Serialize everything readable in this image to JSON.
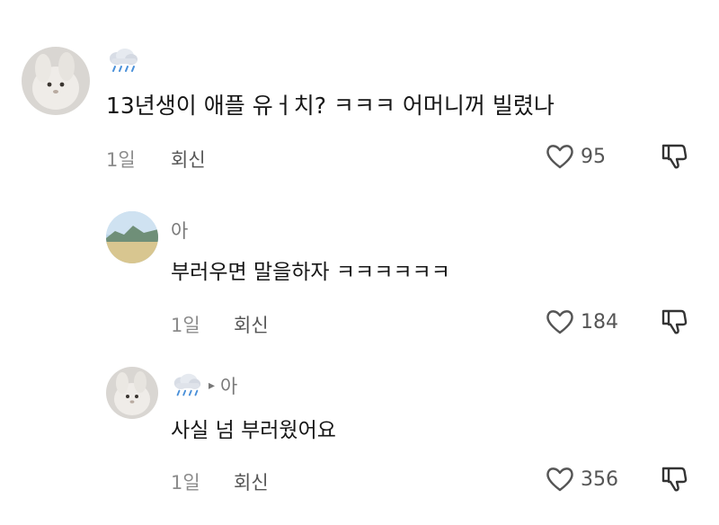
{
  "comments": [
    {
      "username_icon": "rain-cloud-emoji",
      "text": "13년생이 애플 유ㅓ치? ㅋㅋㅋ 어머니꺼 빌렸나",
      "age": "1일",
      "reply_label": "회신",
      "likes": "95"
    },
    {
      "username": "아",
      "text": "부러우면 말을하자 ㅋㅋㅋㅋㅋㅋ",
      "age": "1일",
      "reply_label": "회신",
      "likes": "184"
    },
    {
      "username_icon": "rain-cloud-emoji",
      "reply_arrow": "▸",
      "reply_to": "아",
      "text": "사실 넘 부러웠어요",
      "age": "1일",
      "reply_label": "회신",
      "likes": "356"
    }
  ],
  "icons": {
    "like": "heart-outline-icon",
    "dislike": "thumbs-down-icon",
    "avatar_1": "plush-bunny-photo",
    "avatar_2": "landscape-photo",
    "avatar_3": "plush-bunny-photo"
  }
}
